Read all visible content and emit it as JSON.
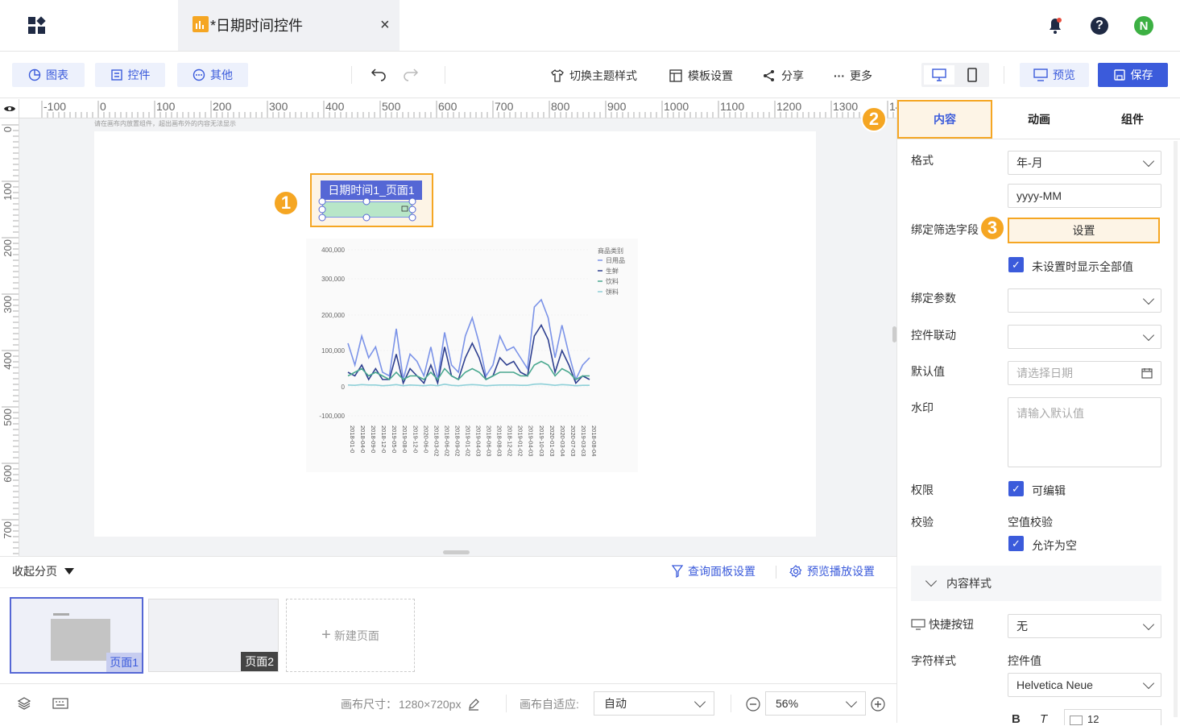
{
  "app": {
    "tab_title": "*日期时间控件",
    "close": "×"
  },
  "toolbar": {
    "chart_btn": "图表",
    "control_btn": "控件",
    "other_btn": "其他",
    "theme": "切换主题样式",
    "template": "模板设置",
    "share": "分享",
    "more": "更多",
    "preview": "预览",
    "save": "保存"
  },
  "user": {
    "avatar_letter": "N"
  },
  "ruler": {
    "h_labels": [
      "-100",
      "0",
      "100",
      "200",
      "300",
      "400",
      "500",
      "600",
      "700",
      "800",
      "900",
      "1000",
      "1100",
      "1200",
      "1300",
      "14"
    ],
    "v_labels": [
      "0",
      "100",
      "200",
      "300",
      "400",
      "500",
      "600",
      "700"
    ]
  },
  "canvas": {
    "hint": "请在画布内放置组件，超出画布外的内容无法显示",
    "widget_label": "日期时间1_页面1"
  },
  "callouts": [
    "1",
    "2",
    "3"
  ],
  "chart_data": {
    "type": "line",
    "title": "",
    "legend_title": "商品类别",
    "series": [
      {
        "name": "日用品",
        "color": "#7b93e8",
        "values": [
          120000,
          60000,
          140000,
          80000,
          110000,
          40000,
          30000,
          160000,
          20000,
          90000,
          70000,
          30000,
          110000,
          20000,
          150000,
          60000,
          40000,
          140000,
          190000,
          120000,
          30000,
          60000,
          140000,
          100000,
          110000,
          80000,
          50000,
          220000,
          240000,
          190000,
          80000,
          170000,
          90000,
          20000,
          60000,
          80000
        ]
      },
      {
        "name": "生鲜",
        "color": "#2e3f8f",
        "values": [
          40000,
          30000,
          60000,
          20000,
          50000,
          20000,
          20000,
          90000,
          10000,
          50000,
          30000,
          10000,
          60000,
          10000,
          110000,
          30000,
          20000,
          80000,
          120000,
          80000,
          20000,
          30000,
          80000,
          60000,
          70000,
          40000,
          30000,
          140000,
          170000,
          130000,
          40000,
          100000,
          60000,
          10000,
          30000,
          20000
        ]
      },
      {
        "name": "饮料",
        "color": "#4aa88f",
        "values": [
          30000,
          40000,
          50000,
          30000,
          40000,
          30000,
          20000,
          40000,
          20000,
          30000,
          30000,
          20000,
          40000,
          20000,
          50000,
          30000,
          20000,
          40000,
          50000,
          40000,
          20000,
          30000,
          40000,
          40000,
          40000,
          30000,
          30000,
          60000,
          70000,
          60000,
          30000,
          50000,
          40000,
          20000,
          30000,
          30000
        ]
      },
      {
        "name": "饼料",
        "color": "#8fd0d8",
        "values": [
          5000,
          4000,
          6000,
          5000,
          5000,
          3000,
          4000,
          6000,
          3000,
          5000,
          4000,
          3000,
          5000,
          3000,
          7000,
          4000,
          3000,
          5000,
          6000,
          5000,
          3000,
          4000,
          5000,
          5000,
          5000,
          4000,
          4000,
          7000,
          8000,
          6000,
          4000,
          6000,
          5000,
          3000,
          4000,
          4000
        ]
      }
    ],
    "y_ticks": [
      "400,000",
      "300,000",
      "200,000",
      "100,000",
      "0",
      "-100,000"
    ],
    "ylim": [
      -100000,
      400000
    ],
    "x_tick_labels": [
      "2018-01-0",
      "2018-04-0",
      "2018-09-0",
      "2018-12-0",
      "2019-05-0",
      "2019-08-0",
      "2019-12-0",
      "2020-06-0",
      "2018-03-02",
      "2018-06-02",
      "2018-09-02",
      "2019-01-02",
      "2019-04-03",
      "2018-06-03",
      "2018-08-03",
      "2018-12-02",
      "2019-01-02",
      "2019-04-03",
      "2019-10-03",
      "2020-01-03",
      "2020-03-04",
      "2020-07-03",
      "2019-03-03",
      "2018-08-04"
    ],
    "grid": true,
    "legend_position": "top-right"
  },
  "right_panel": {
    "tabs": [
      "内容",
      "动画",
      "组件"
    ],
    "format_label": "格式",
    "format_value": "年-月",
    "format_pattern": "yyyy-MM",
    "bind_filter_label": "绑定筛选字段",
    "settings_btn": "设置",
    "show_all_label": "未设置时显示全部值",
    "bind_param_label": "绑定参数",
    "control_link_label": "控件联动",
    "default_label": "默认值",
    "default_placeholder": "请选择日期",
    "watermark_label": "水印",
    "watermark_placeholder": "请输入默认值",
    "permission_label": "权限",
    "editable_label": "可编辑",
    "validate_label": "校验",
    "empty_check_label": "空值校验",
    "allow_empty_label": "允许为空",
    "content_style_label": "内容样式",
    "quick_btn_label": "快捷按钮",
    "quick_btn_value": "无",
    "char_style_label": "字符样式",
    "control_value_label": "控件值",
    "font_value": "Helvetica Neue",
    "bold": "B",
    "italic": "T",
    "font_size": "12"
  },
  "pager": {
    "collapse_label": "收起分页",
    "query_panel": "查询面板设置",
    "preview_play": "预览播放设置",
    "pages": [
      "页面1",
      "页面2"
    ],
    "new_page": "新建页面"
  },
  "bottom": {
    "canvas_size_label": "画布尺寸：",
    "canvas_size_value": "1280×720px",
    "adapt_label": "画布自适应:",
    "adapt_value": "自动",
    "zoom_value": "56%"
  }
}
